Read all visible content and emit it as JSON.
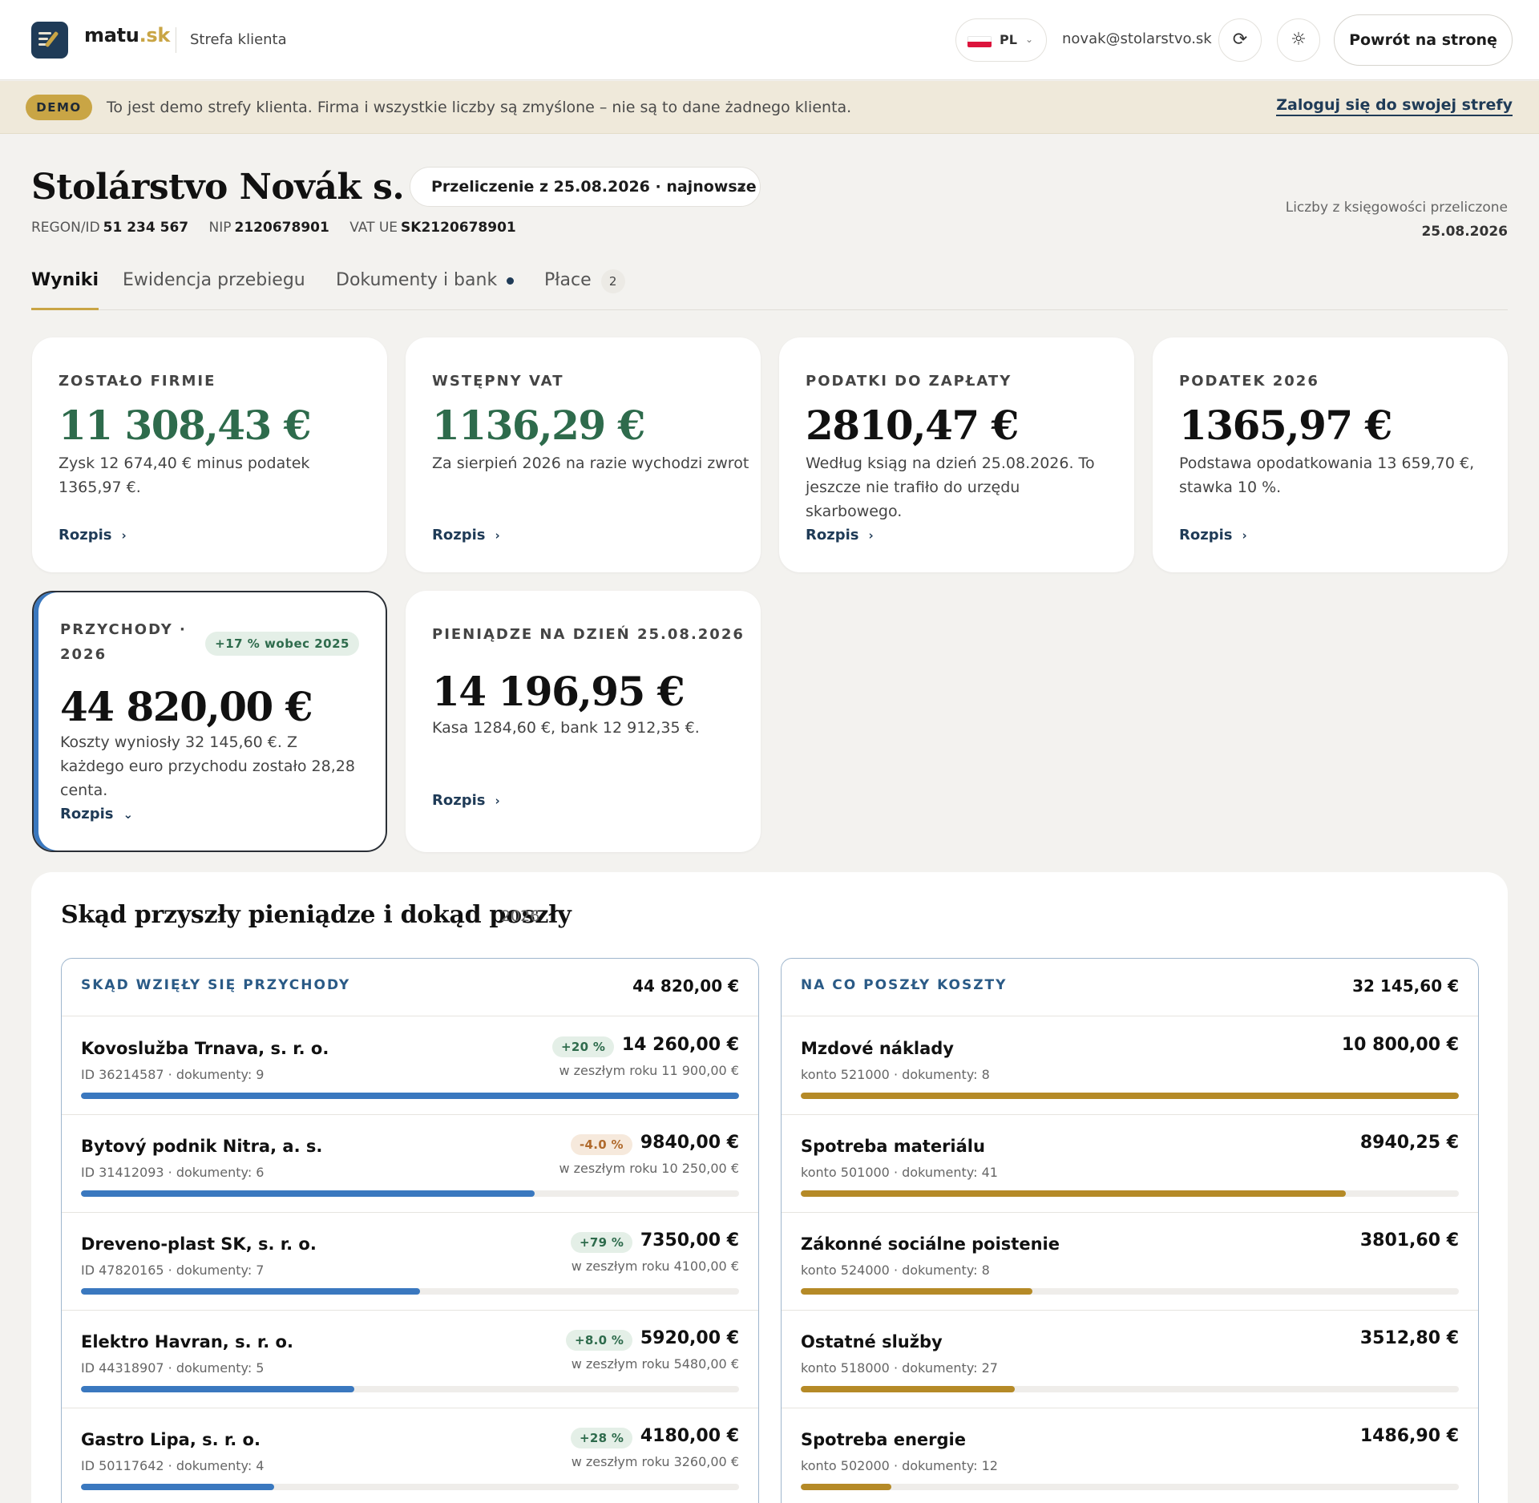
{
  "header": {
    "brand_main": "matu",
    "brand_tld": ".sk",
    "zone": "Strefa klienta",
    "lang": "PL",
    "email": "novak@stolarstvo.sk",
    "back_label": "Powrót na stronę"
  },
  "demo": {
    "badge": "DEMO",
    "text": "To jest demo strefy klienta. Firma i wszystkie liczby są zmyślone – nie są to dane żadnego klienta.",
    "login": "Zaloguj się do swojej strefy"
  },
  "company": {
    "name": "Stolárstvo Novák s. r. o.",
    "recalc": "Przeliczenie z 25.08.2026 · najnowsze",
    "regon_label": "REGON/ID",
    "regon": "51 234 567",
    "nip_label": "NIP",
    "nip": "2120678901",
    "vat_label": "VAT UE",
    "vat": "SK2120678901",
    "note": "Liczby z księgowości przeliczone",
    "note_date": "25.08.2026"
  },
  "tabs": [
    {
      "label": "Wyniki"
    },
    {
      "label": "Ewidencja przebiegu"
    },
    {
      "label": "Dokumenty i bank"
    },
    {
      "label": "Płace",
      "count": "2"
    }
  ],
  "cards": {
    "zostalo": {
      "label": "Zostało firmie",
      "value": "11 308,43 €",
      "desc": "Zysk 12 674,40 € minus podatek 1365,97 €.",
      "more": "Rozpis"
    },
    "vat": {
      "label": "Wstępny VAT",
      "value": "1136,29 €",
      "desc": "Za sierpień 2026 na razie wychodzi zwrot",
      "more": "Rozpis"
    },
    "podatki": {
      "label": "Podatki do zapłaty",
      "value": "2810,47 €",
      "desc": "Według ksiąg na dzień 25.08.2026. To jeszcze nie trafiło do urzędu skarbowego.",
      "more": "Rozpis"
    },
    "podatek": {
      "label": "Podatek 2026",
      "value": "1365,97 €",
      "desc": "Podstawa opodatkowania 13 659,70 €, stawka 10 %.",
      "more": "Rozpis"
    },
    "przychody": {
      "label_1": "Przychody ·",
      "label_2": "2026",
      "trend": "+17 % wobec 2025",
      "value": "44 820,00 €",
      "desc": "Koszty wyniosły 32 145,60 €. Z każdego euro przychodu zostało 28,28 centa.",
      "more": "Rozpis"
    },
    "pieniadze": {
      "label": "Pieniądze na dzień 25.08.2026",
      "value": "14 196,95 €",
      "desc": "Kasa 1284,60 €, bank 12 912,35 €.",
      "more": "Rozpis"
    }
  },
  "flows": {
    "title": "Skąd przyszły pieniądze i dokąd poszły",
    "year": "2026",
    "income": {
      "label": "Skąd wzięły się przychody",
      "total": "44 820,00 €",
      "rows": [
        {
          "name": "Kovoslužba Trnava, s. r. o.",
          "sub": "ID 36214587 · dokumenty: 9",
          "amount": "14 260,00 €",
          "change": "+20 %",
          "dir": "up",
          "prev": "w zeszłym roku 11 900,00 €",
          "share": 1.0
        },
        {
          "name": "Bytový podnik Nitra, a. s.",
          "sub": "ID 31412093 · dokumenty: 6",
          "amount": "9840,00 €",
          "change": "-4.0 %",
          "dir": "down",
          "prev": "w zeszłym roku 10 250,00 €",
          "share": 0.69
        },
        {
          "name": "Dreveno-plast SK, s. r. o.",
          "sub": "ID 47820165 · dokumenty: 7",
          "amount": "7350,00 €",
          "change": "+79 %",
          "dir": "up",
          "prev": "w zeszłym roku 4100,00 €",
          "share": 0.515
        },
        {
          "name": "Elektro Havran, s. r. o.",
          "sub": "ID 44318907 · dokumenty: 5",
          "amount": "5920,00 €",
          "change": "+8.0 %",
          "dir": "up",
          "prev": "w zeszłym roku 5480,00 €",
          "share": 0.415
        },
        {
          "name": "Gastro Lipa, s. r. o.",
          "sub": "ID 50117642 · dokumenty: 4",
          "amount": "4180,00 €",
          "change": "+28 %",
          "dir": "up",
          "prev": "w zeszłym roku 3260,00 €",
          "share": 0.293
        }
      ]
    },
    "costs": {
      "label": "Na co poszły koszty",
      "total": "32 145,60 €",
      "rows": [
        {
          "name": "Mzdové náklady",
          "sub": "konto 521000 · dokumenty: 8",
          "amount": "10 800,00 €",
          "share": 1.0
        },
        {
          "name": "Spotreba materiálu",
          "sub": "konto 501000 · dokumenty: 41",
          "amount": "8940,25 €",
          "share": 0.828
        },
        {
          "name": "Zákonné sociálne poistenie",
          "sub": "konto 524000 · dokumenty: 8",
          "amount": "3801,60 €",
          "share": 0.352
        },
        {
          "name": "Ostatné služby",
          "sub": "konto 518000 · dokumenty: 27",
          "amount": "3512,80 €",
          "share": 0.325
        },
        {
          "name": "Spotreba energie",
          "sub": "konto 502000 · dokumenty: 12",
          "amount": "1486,90 €",
          "share": 0.138
        }
      ]
    }
  },
  "colors": {
    "accent_gold": "#c9a545",
    "navy": "#1f3b57",
    "income_bar": "#3a78bf",
    "cost_bar": "#b58a27",
    "positive": "#2e6b4c",
    "negative": "#b06a2c"
  }
}
